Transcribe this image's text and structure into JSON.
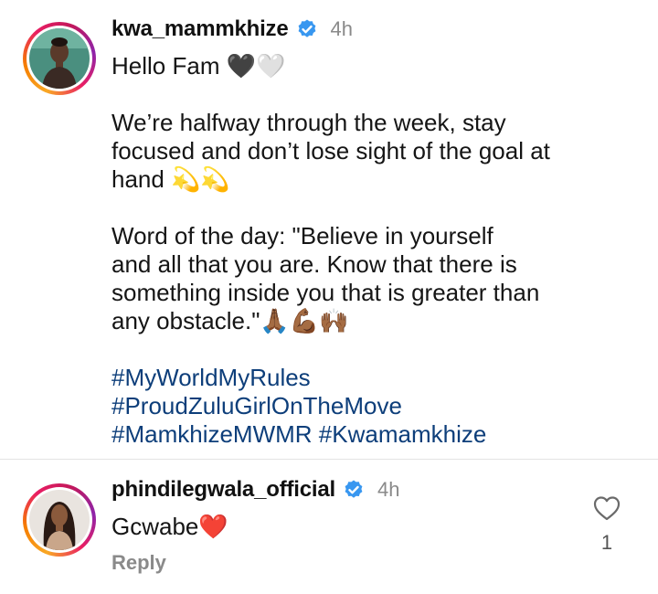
{
  "post": {
    "username": "kwa_mammkhize",
    "timestamp": "4h",
    "greeting": "Hello Fam 🖤🤍",
    "paragraph1": "We’re halfway through the week, stay\nfocused and don’t lose sight of the goal at\nhand 💫💫",
    "paragraph2": "Word of the day: \"Believe in yourself\nand all that you are. Know that there is\nsomething inside you that is greater than\nany obstacle.\"🙏🏾💪🏾🙌🏾",
    "hashtags": [
      "#MyWorldMyRules",
      "#ProudZuluGirlOnTheMove",
      "#MamkhizeMWMR #Kwamamkhize"
    ]
  },
  "comment": {
    "username": "phindilegwala_official",
    "timestamp": "4h",
    "text": "Gcwabe❤️",
    "reply_label": "Reply",
    "like_count": "1"
  },
  "icons": {
    "verified": "verified-badge-icon",
    "like": "heart-outline-icon"
  },
  "colors": {
    "verified": "#3897f0",
    "hashtag": "#0d3e7a",
    "muted": "#8a8a8a"
  }
}
